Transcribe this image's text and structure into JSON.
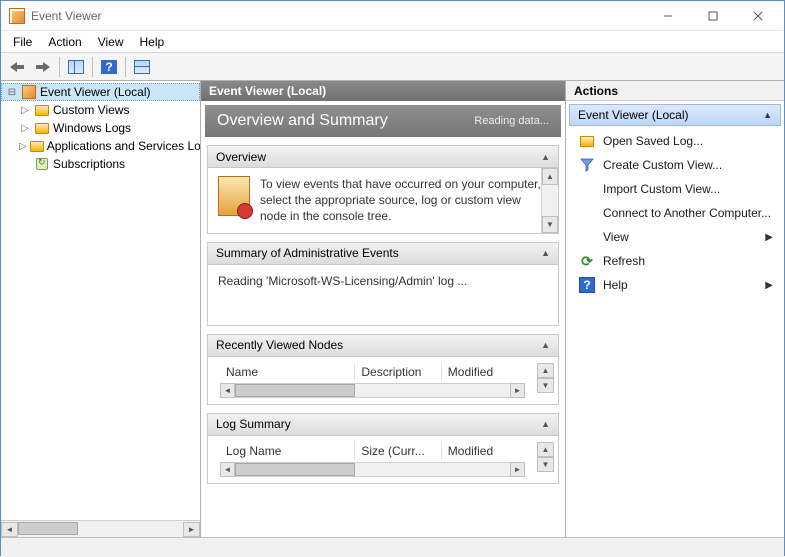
{
  "window": {
    "title": "Event Viewer"
  },
  "menu": {
    "file": "File",
    "action": "Action",
    "view": "View",
    "help": "Help"
  },
  "tree": {
    "root": "Event Viewer (Local)",
    "items": [
      {
        "label": "Custom Views"
      },
      {
        "label": "Windows Logs"
      },
      {
        "label": "Applications and Services Lo"
      },
      {
        "label": "Subscriptions"
      }
    ]
  },
  "center": {
    "header": "Event Viewer (Local)",
    "overview_title": "Overview and Summary",
    "overview_status": "Reading data...",
    "overview_section": {
      "title": "Overview",
      "text": "To view events that have occurred on your computer, select the appropriate source, log or custom view node in the console tree."
    },
    "summary_section": {
      "title": "Summary of Administrative Events",
      "text": "Reading 'Microsoft-WS-Licensing/Admin' log ..."
    },
    "recent_section": {
      "title": "Recently Viewed Nodes",
      "cols": {
        "name": "Name",
        "description": "Description",
        "modified": "Modified"
      }
    },
    "logsum_section": {
      "title": "Log Summary",
      "cols": {
        "logname": "Log Name",
        "size": "Size (Curr...",
        "modified": "Modified"
      }
    }
  },
  "actions": {
    "header": "Actions",
    "group": "Event Viewer (Local)",
    "items": {
      "open_saved": "Open Saved Log...",
      "create_view": "Create Custom View...",
      "import_view": "Import Custom View...",
      "connect": "Connect to Another Computer...",
      "view": "View",
      "refresh": "Refresh",
      "help": "Help"
    }
  }
}
